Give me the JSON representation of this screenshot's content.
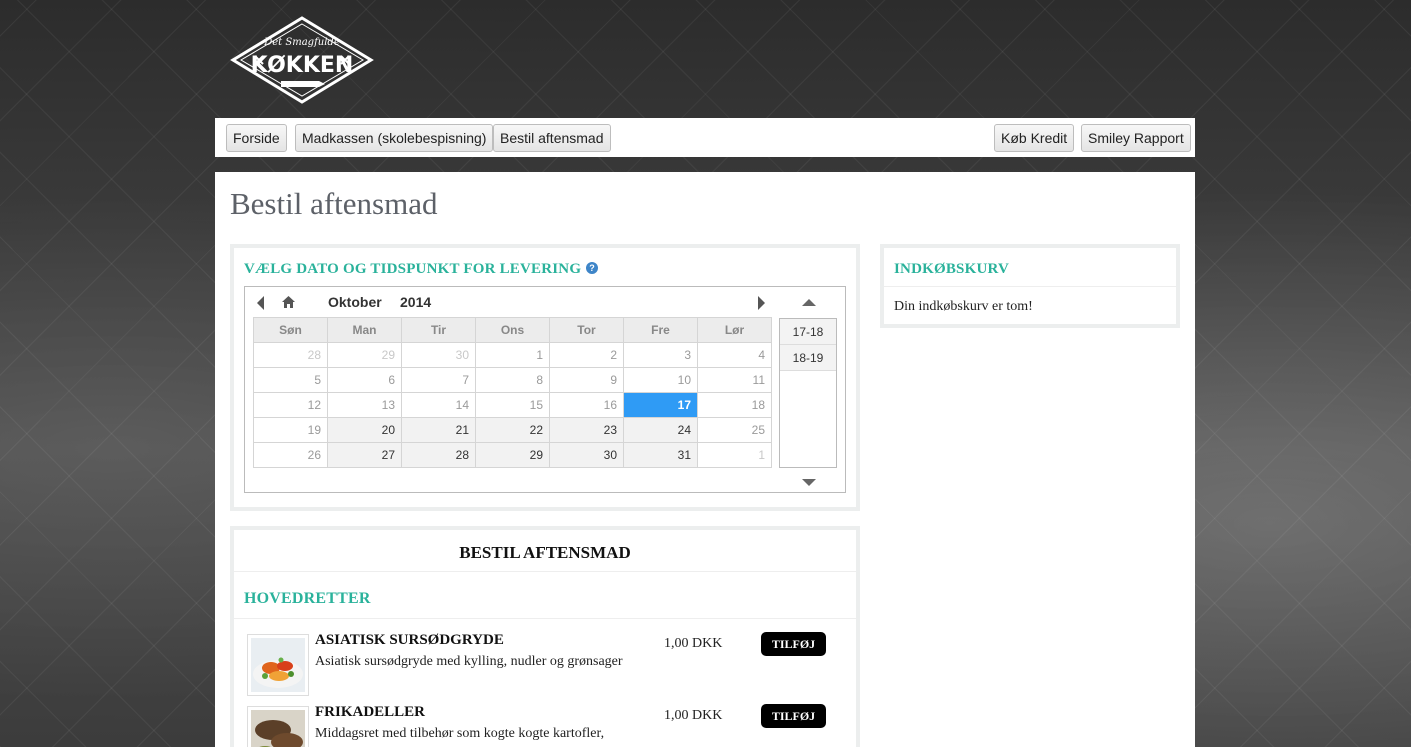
{
  "logo": {
    "script_text": "Det Smagfulde",
    "main_text": "KØKKEN"
  },
  "nav": {
    "left": [
      "Forside",
      "Madkassen (skolebespisning)",
      "Bestil aftensmad"
    ],
    "right": [
      "Køb Kredit",
      "Smiley Rapport"
    ]
  },
  "page": {
    "title": "Bestil aftensmad"
  },
  "delivery": {
    "title": "VÆLG DATO OG TIDSPUNKT FOR LEVERING",
    "help_icon": "question-icon"
  },
  "calendar": {
    "month": "Oktober",
    "year": "2014",
    "weekdays": [
      "Søn",
      "Man",
      "Tir",
      "Ons",
      "Tor",
      "Fre",
      "Lør"
    ],
    "weeks": [
      [
        {
          "d": "28",
          "s": "other"
        },
        {
          "d": "29",
          "s": "other"
        },
        {
          "d": "30",
          "s": "other"
        },
        {
          "d": "1",
          "s": "dis"
        },
        {
          "d": "2",
          "s": "dis"
        },
        {
          "d": "3",
          "s": "dis"
        },
        {
          "d": "4",
          "s": "dis"
        }
      ],
      [
        {
          "d": "5",
          "s": "dis"
        },
        {
          "d": "6",
          "s": "dis"
        },
        {
          "d": "7",
          "s": "dis"
        },
        {
          "d": "8",
          "s": "dis"
        },
        {
          "d": "9",
          "s": "dis"
        },
        {
          "d": "10",
          "s": "dis"
        },
        {
          "d": "11",
          "s": "dis"
        }
      ],
      [
        {
          "d": "12",
          "s": "dis"
        },
        {
          "d": "13",
          "s": "dis"
        },
        {
          "d": "14",
          "s": "dis"
        },
        {
          "d": "15",
          "s": "dis"
        },
        {
          "d": "16",
          "s": "dis"
        },
        {
          "d": "17",
          "s": "sel"
        },
        {
          "d": "18",
          "s": "dis"
        }
      ],
      [
        {
          "d": "19",
          "s": "dis"
        },
        {
          "d": "20",
          "s": "av"
        },
        {
          "d": "21",
          "s": "av"
        },
        {
          "d": "22",
          "s": "av"
        },
        {
          "d": "23",
          "s": "av"
        },
        {
          "d": "24",
          "s": "av"
        },
        {
          "d": "25",
          "s": "dis"
        }
      ],
      [
        {
          "d": "26",
          "s": "dis"
        },
        {
          "d": "27",
          "s": "av"
        },
        {
          "d": "28",
          "s": "av"
        },
        {
          "d": "29",
          "s": "av"
        },
        {
          "d": "30",
          "s": "av"
        },
        {
          "d": "31",
          "s": "av"
        },
        {
          "d": "1",
          "s": "other"
        }
      ]
    ],
    "times": [
      "17-18",
      "18-19"
    ]
  },
  "cart": {
    "title": "INDKØBSKURV",
    "empty_text": "Din indkøbskurv er tom!"
  },
  "order": {
    "title": "BESTIL AFTENSMAD",
    "section": "HOVEDRETTER",
    "dishes": [
      {
        "name": "ASIATISK SURSØDGRYDE",
        "desc": "Asiatisk sursødgryde med kylling, nudler og grønsager",
        "price": "1,00 DKK",
        "button": "TILFØJ"
      },
      {
        "name": "FRIKADELLER",
        "desc": "Middagsret med tilbehør som kogte kogte kartofler,",
        "price": "1,00 DKK",
        "button": "TILFØJ"
      }
    ]
  },
  "colors": {
    "accent": "#2ab29b",
    "selected_day": "#2f9bf5"
  }
}
